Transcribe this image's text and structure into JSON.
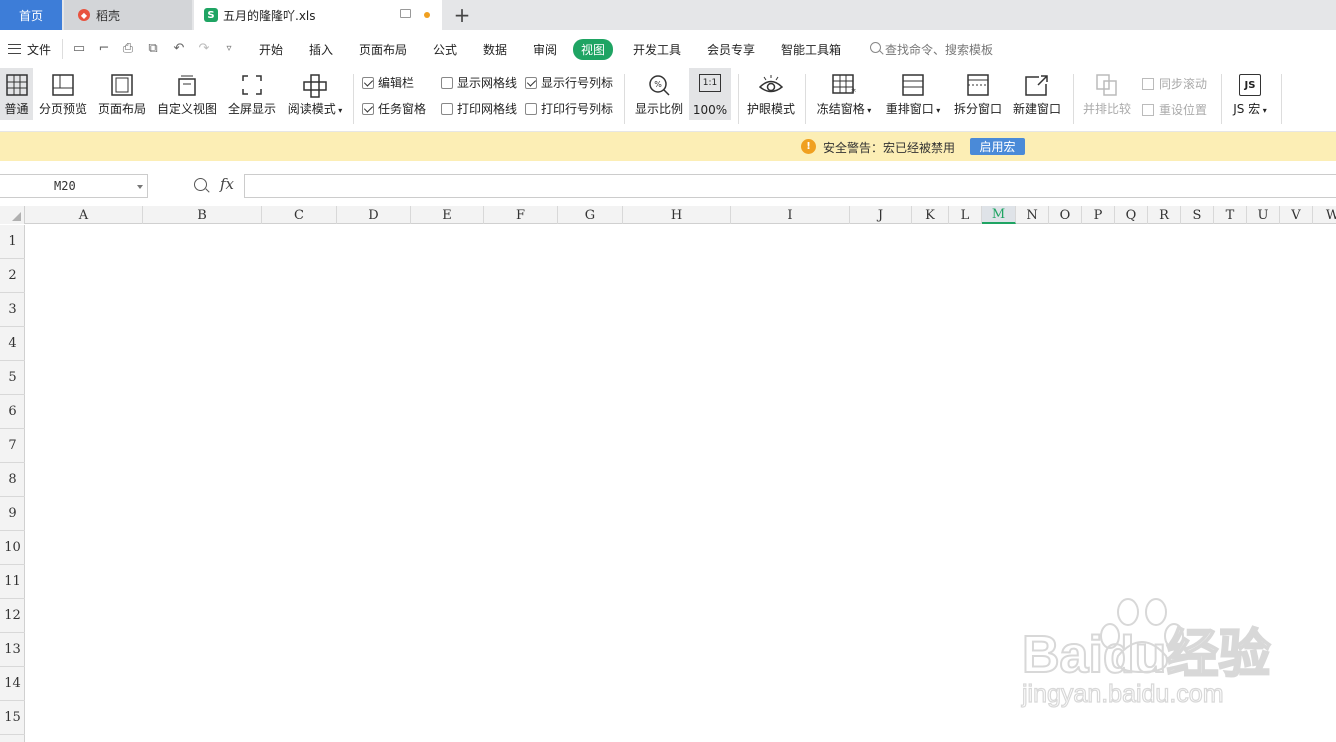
{
  "tabs": {
    "home": "首页",
    "daoke": "稻壳",
    "file": "五月的隆隆吖.xls",
    "add": "+"
  },
  "menu": {
    "file": "文件",
    "items": [
      "开始",
      "插入",
      "页面布局",
      "公式",
      "数据",
      "审阅",
      "视图",
      "开发工具",
      "会员专享",
      "智能工具箱"
    ],
    "active_index": 6,
    "search_placeholder": "查找命令、搜索模板"
  },
  "ribbon": {
    "normal": "普通",
    "page_break_preview": "分页预览",
    "page_layout": "页面布局",
    "custom_view": "自定义视图",
    "full_screen": "全屏显示",
    "reading_mode": "阅读模式",
    "checks": [
      {
        "label": "编辑栏",
        "checked": true
      },
      {
        "label": "任务窗格",
        "checked": true
      },
      {
        "label": "显示网格线",
        "checked": false
      },
      {
        "label": "打印网格线",
        "checked": false
      },
      {
        "label": "显示行号列标",
        "checked": true
      },
      {
        "label": "打印行号列标",
        "checked": false
      }
    ],
    "zoom_ratio": "显示比例",
    "zoom_100": "100%",
    "zoom_100_icon": "1:1",
    "eye_mode": "护眼模式",
    "freeze_panes": "冻结窗格",
    "arrange_windows": "重排窗口",
    "split_window": "拆分窗口",
    "new_window": "新建窗口",
    "side_by_side": "并排比较",
    "sync_scroll": "同步滚动",
    "reset_position": "重设位置",
    "js_macro": "JS 宏",
    "js_icon": "JS"
  },
  "warning": {
    "icon": "!",
    "text": "安全警告：宏已经被禁用",
    "button": "启用宏",
    "color": "#fceeb5"
  },
  "formula": {
    "name_box": "M20",
    "fx": "fx",
    "value": ""
  },
  "sheet": {
    "columns": [
      "A",
      "B",
      "C",
      "D",
      "E",
      "F",
      "G",
      "H",
      "I",
      "J",
      "K",
      "L",
      "M",
      "N",
      "O",
      "P",
      "Q",
      "R",
      "S",
      "T",
      "U",
      "V",
      "W"
    ],
    "selected_column": "M",
    "rows": [
      "1",
      "2",
      "3",
      "4",
      "5",
      "6",
      "7",
      "8",
      "9",
      "10",
      "11",
      "12",
      "13",
      "14",
      "15"
    ]
  },
  "watermark": {
    "brand": "Baidu经验",
    "url": "jingyan.baidu.com"
  },
  "colors": {
    "accent": "#1fa463",
    "home_tab": "#3d7dd8",
    "enable_macro_button": "#4a8ad8"
  }
}
